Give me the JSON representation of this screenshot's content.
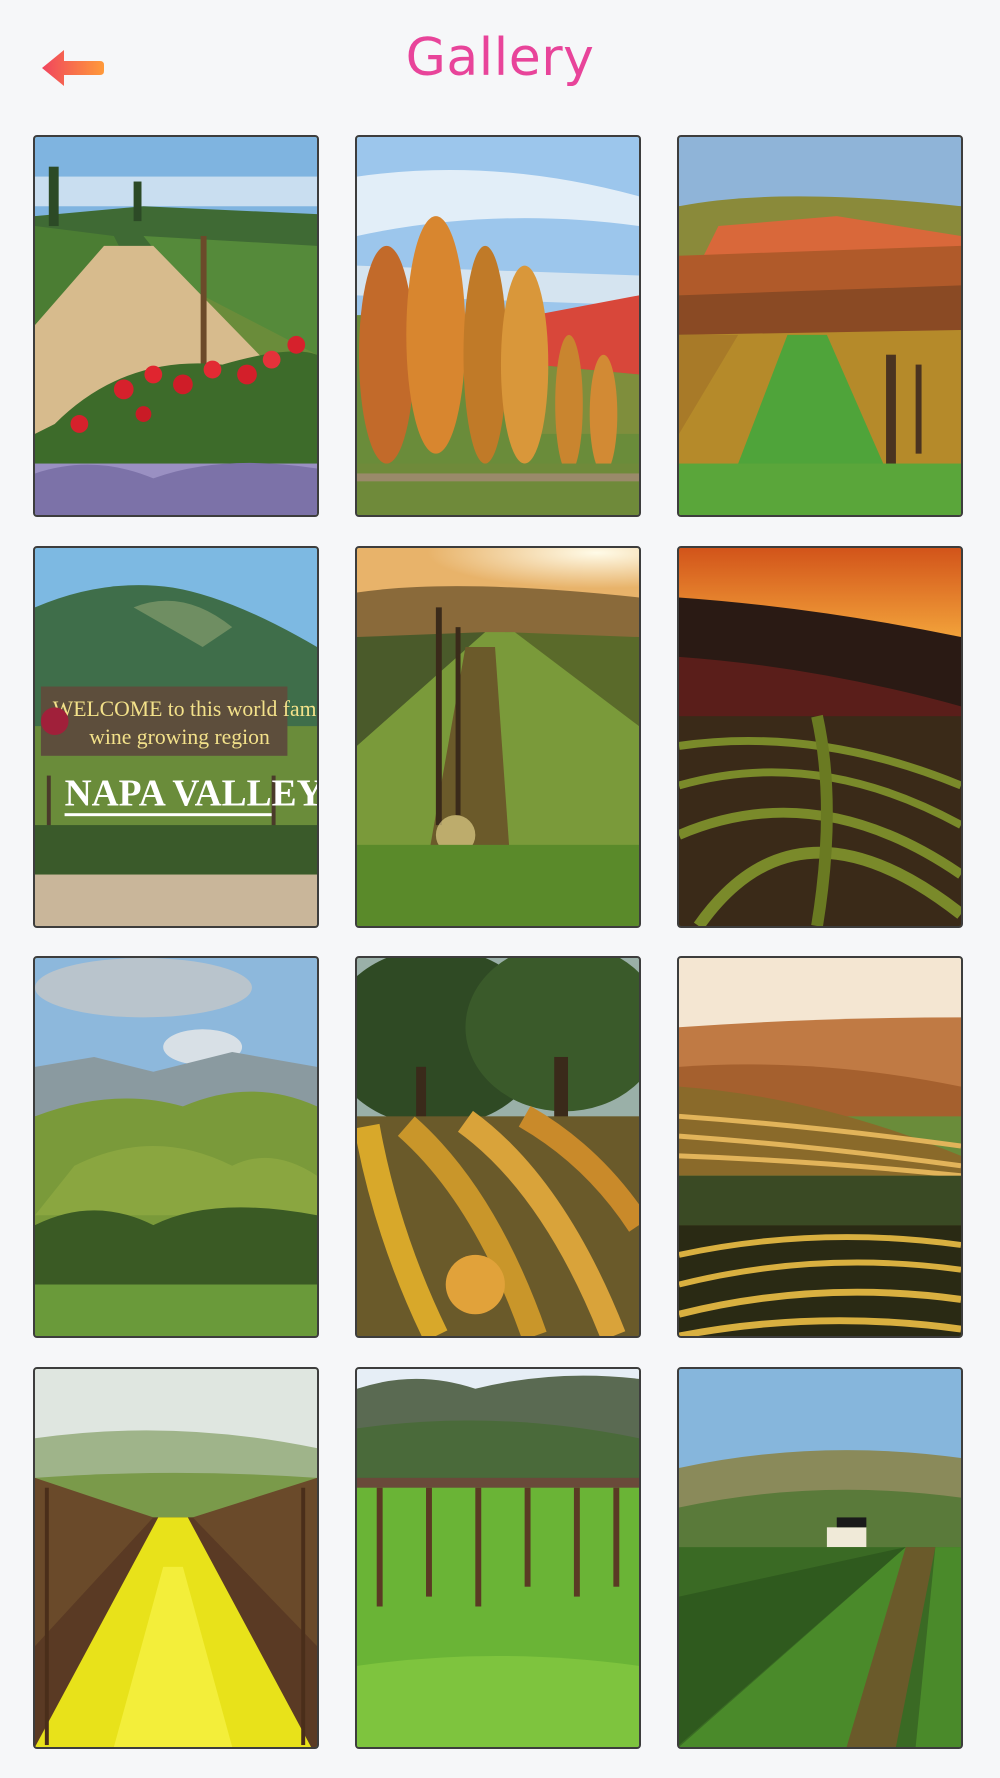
{
  "header": {
    "title": "Gallery",
    "back_icon": "back-arrow-icon",
    "title_color": "#e8449a",
    "back_colors": [
      "#ff9a3a",
      "#f0455e"
    ]
  },
  "gallery": {
    "items": [
      {
        "subject": "vineyard row with red roses"
      },
      {
        "subject": "autumn poplar trees and hills"
      },
      {
        "subject": "terraced autumn vineyard"
      },
      {
        "subject": "Napa Valley welcome sign",
        "sign_line1": "WELCOME to this world famous",
        "sign_line2": "wine growing region",
        "sign_name": "NAPA VALLEY"
      },
      {
        "subject": "sunlit vineyard row"
      },
      {
        "subject": "sunset vineyard rows"
      },
      {
        "subject": "green rolling hills"
      },
      {
        "subject": "oak tree above autumn vines"
      },
      {
        "subject": "golden hillside vineyard"
      },
      {
        "subject": "yellow mustard between vines"
      },
      {
        "subject": "winter vines with green grass"
      },
      {
        "subject": "modern winery among vines"
      }
    ]
  }
}
